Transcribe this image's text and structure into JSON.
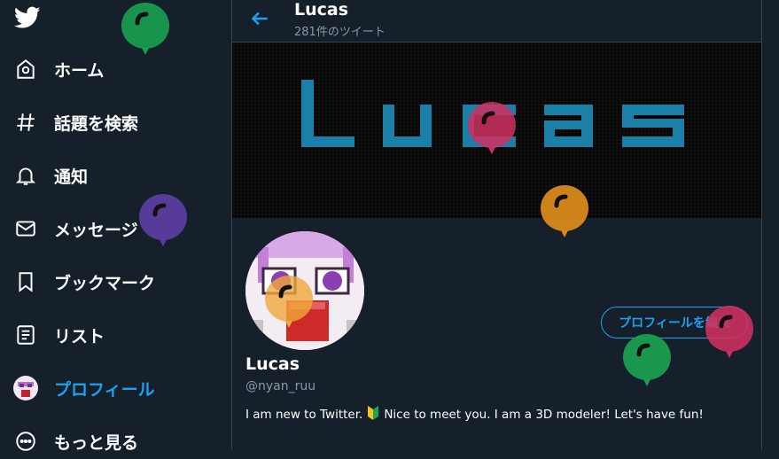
{
  "nav": {
    "items": [
      {
        "label": "ホーム",
        "icon": "home-icon"
      },
      {
        "label": "話題を検索",
        "icon": "hashtag-icon"
      },
      {
        "label": "通知",
        "icon": "bell-icon"
      },
      {
        "label": "メッセージ",
        "icon": "mail-icon"
      },
      {
        "label": "ブックマーク",
        "icon": "bookmark-icon"
      },
      {
        "label": "リスト",
        "icon": "list-icon"
      },
      {
        "label": "プロフィール",
        "icon": "avatar-icon",
        "active": true
      },
      {
        "label": "もっと見る",
        "icon": "more-icon"
      }
    ],
    "accent": "#1da1f2"
  },
  "header": {
    "name": "Lucas",
    "tweet_count": "281件のツイート"
  },
  "banner": {
    "text": "Lucas"
  },
  "profile": {
    "name": "Lucas",
    "handle": "@nyan_ruu",
    "edit_label": "プロフィールを編集",
    "bio_before": "I am new to Twitter.",
    "bio_after": "Nice to meet you. I am a 3D modeler! Let's have fun!"
  },
  "colors": {
    "background": "#15202b",
    "border": "#38444d",
    "muted": "#8899a6",
    "accent": "#1da1f2"
  }
}
